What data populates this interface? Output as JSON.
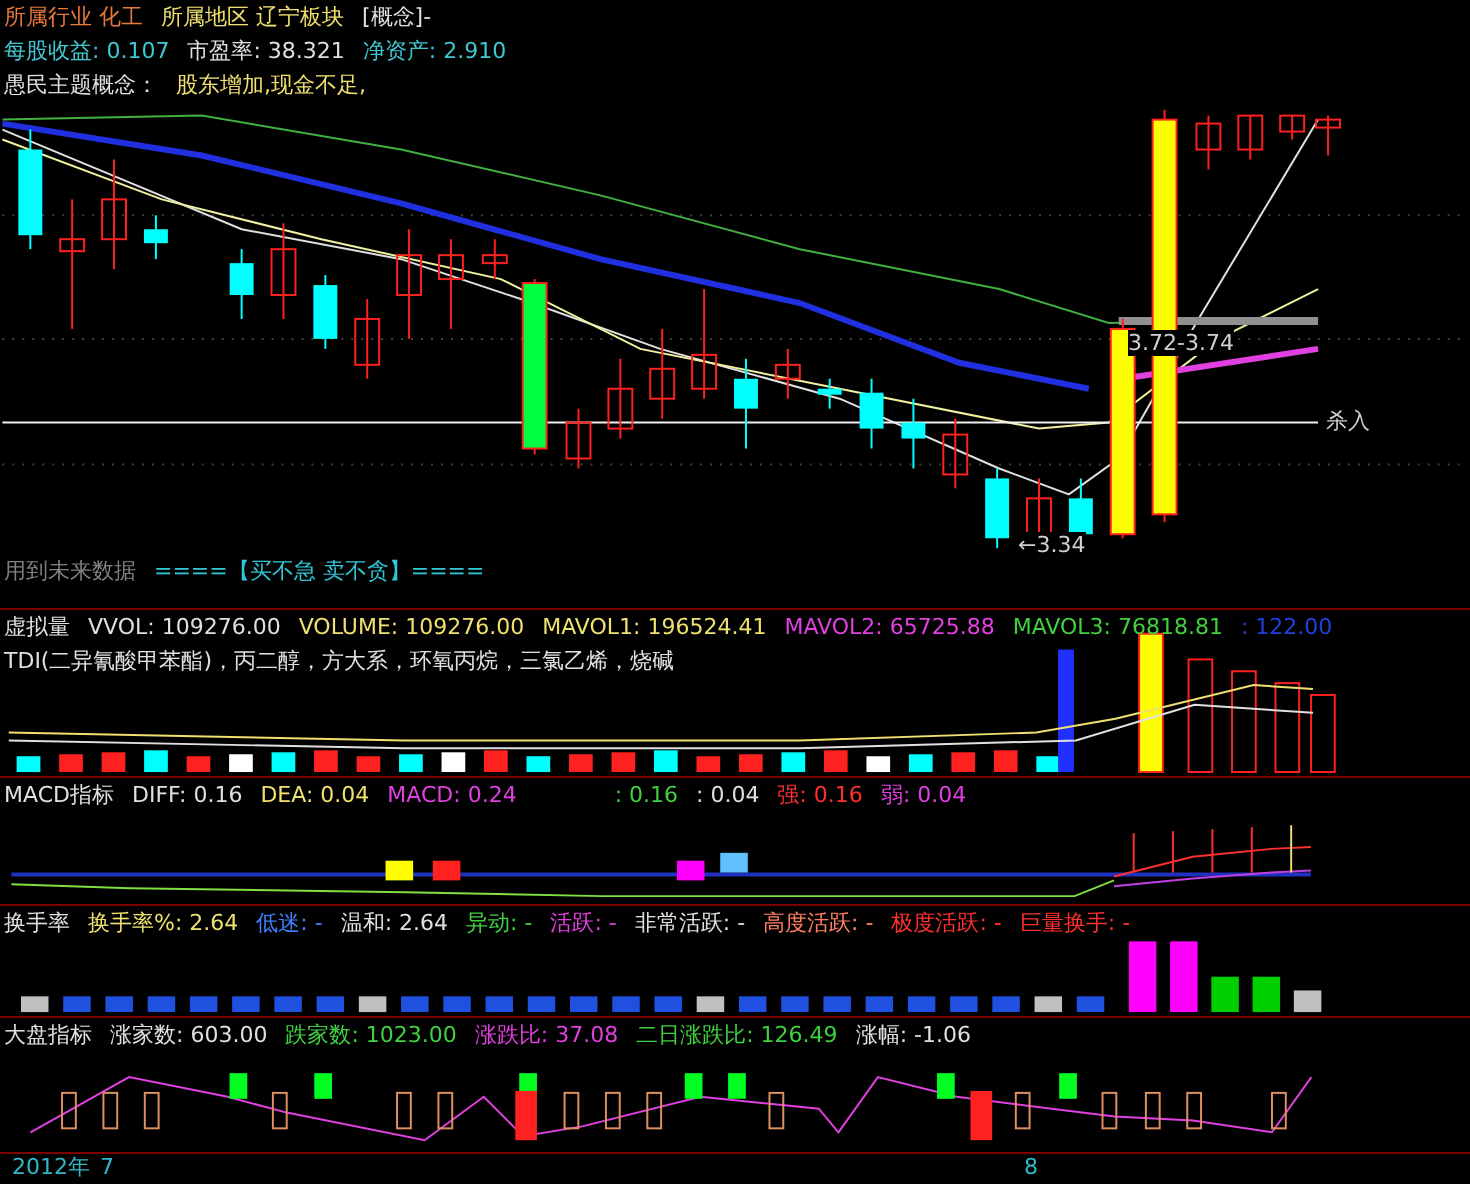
{
  "main": {
    "header_lines": [
      [
        {
          "text": "所属行业 化工",
          "color": "#e8783c"
        },
        {
          "text": "所属地区 辽宁板块",
          "color": "#f0e070"
        },
        {
          "text": "[概念]-",
          "color": "#e0e0e0"
        }
      ],
      [
        {
          "text": "每股收益: 0.107",
          "color": "#40c8d0"
        },
        {
          "text": "市盈率: 38.321",
          "color": "#e0e0e0"
        },
        {
          "text": "净资产:  2.910",
          "color": "#40c8d0"
        }
      ],
      [
        {
          "text": "愚民主题概念：",
          "color": "#e0e0e0"
        },
        {
          "text": "股东增加,现金不足,",
          "color": "#f0e070"
        }
      ]
    ],
    "annotations": [
      {
        "text": "3.72-3.74"
      },
      {
        "text": "杀入"
      },
      {
        "text": "←3.34"
      }
    ],
    "footer": [
      {
        "text": "用到未来数据",
        "color": "#808080"
      },
      {
        "text": "====【买不急  卖不贪】====",
        "color": "#30c8d8"
      }
    ]
  },
  "volume": {
    "legend": [
      {
        "text": "虚拟量",
        "color": "#e0e0e0"
      },
      {
        "text": "VVOL: 109276.00",
        "color": "#e0e0e0"
      },
      {
        "text": "VOLUME: 109276.00",
        "color": "#f0e070"
      },
      {
        "text": "MAVOL1: 196524.41",
        "color": "#f0e070"
      },
      {
        "text": "MAVOL2: 65725.88",
        "color": "#e040e0"
      },
      {
        "text": "MAVOL3: 76818.81",
        "color": "#40d040"
      },
      {
        "text": ": 122.00",
        "color": "#2040e0"
      }
    ],
    "note": "TDI(二异氰酸甲苯酯)，丙二醇，方大系，环氧丙烷，三氯乙烯，烧碱"
  },
  "macd": {
    "legend": [
      {
        "text": "MACD指标",
        "color": "#e0e0e0"
      },
      {
        "text": "DIFF: 0.16",
        "color": "#e0e0e0"
      },
      {
        "text": "DEA: 0.04",
        "color": "#f0e070"
      },
      {
        "text": "MACD: 0.24",
        "color": "#e040e0"
      }
    ],
    "signals": [
      {
        "text": ": 0.16",
        "color": "#40d040"
      },
      {
        "text": ": 0.04",
        "color": "#e0e0e0"
      },
      {
        "text": "强: 0.16",
        "color": "#ff3030"
      },
      {
        "text": "弱: 0.04",
        "color": "#e040e0"
      }
    ]
  },
  "turnover": {
    "legend": [
      {
        "text": "换手率",
        "color": "#e0e0e0"
      },
      {
        "text": "换手率%: 2.64",
        "color": "#f0e070"
      },
      {
        "text": "低迷: -",
        "color": "#4080ff"
      },
      {
        "text": "温和: 2.64",
        "color": "#e0e0e0"
      },
      {
        "text": "异动: -",
        "color": "#40d040"
      },
      {
        "text": "活跃: -",
        "color": "#e040e0"
      },
      {
        "text": "非常活跃: -",
        "color": "#e0e0e0"
      },
      {
        "text": "高度活跃: -",
        "color": "#ff8060"
      },
      {
        "text": "极度活跃: -",
        "color": "#ff3030"
      },
      {
        "text": "巨量换手: -",
        "color": "#ff3030"
      }
    ]
  },
  "market": {
    "legend": [
      {
        "text": "大盘指标",
        "color": "#e0e0e0"
      },
      {
        "text": "涨家数: 603.00",
        "color": "#e0e0e0"
      },
      {
        "text": "跌家数: 1023.00",
        "color": "#40d040"
      },
      {
        "text": "涨跌比: 37.08",
        "color": "#e040e0"
      },
      {
        "text": "二日涨跌比: 126.49",
        "color": "#40d040"
      },
      {
        "text": "涨幅: -1.06",
        "color": "#e0e0e0"
      }
    ]
  },
  "time_axis": {
    "labels": [
      "2012年",
      "7",
      "8"
    ]
  }
}
